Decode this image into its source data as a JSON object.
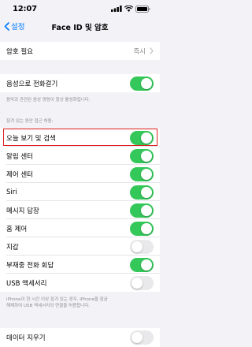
{
  "status_bar": {
    "time": "12:07"
  },
  "nav": {
    "back_label": "설정",
    "title": "Face ID 및 암호"
  },
  "passcode": {
    "label": "암호 필요",
    "value": "즉시"
  },
  "voice_dial": {
    "label": "음성으로 전화걸기",
    "enabled": true,
    "footnote": "음악과 관련된 음성 명령이 항상 활성화됩니다."
  },
  "lock_access": {
    "header": "잠겨 있는 동안 접근 허용:",
    "items": [
      {
        "label": "오늘 보기 및 검색",
        "enabled": true
      },
      {
        "label": "알림 센터",
        "enabled": true
      },
      {
        "label": "제어 센터",
        "enabled": true
      },
      {
        "label": "Siri",
        "enabled": true
      },
      {
        "label": "메시지 답장",
        "enabled": true
      },
      {
        "label": "홈 제어",
        "enabled": true
      },
      {
        "label": "지갑",
        "enabled": false
      },
      {
        "label": "부재중 전화 회답",
        "enabled": true
      },
      {
        "label": "USB 액세서리",
        "enabled": false
      }
    ],
    "footnote_line1": "iPhone이 한 시간 이상 잠겨 있는 경우, iPhone을 잠금",
    "footnote_line2": "해제하여 USB 액세서리의 연결을 허용합니다."
  },
  "erase_data": {
    "label": "데이터 지우기",
    "enabled": false
  },
  "colors": {
    "accent": "#007aff",
    "toggle_on": "#34c759",
    "toggle_off": "#e9e9eb",
    "highlight": "#e0201d",
    "background": "#f2f2f7"
  }
}
